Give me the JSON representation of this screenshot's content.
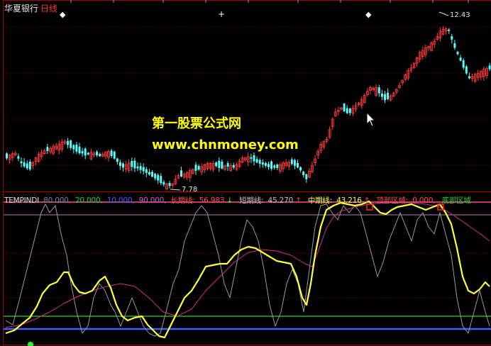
{
  "window": {
    "stock_name": "华夏银行",
    "period": "日线"
  },
  "watermark": {
    "line1": "第一股票公式网",
    "line2": "www.chnmoney.com"
  },
  "price_panel": {
    "high_label": "12.43",
    "low_label": "7.78"
  },
  "indicator_legend": {
    "name": "TEMPINDI",
    "params": [
      {
        "text": "80.000,",
        "color": "#8080a0"
      },
      {
        "text": "20.000,",
        "color": "#30d030"
      },
      {
        "text": "10.000,",
        "color": "#4060ff"
      },
      {
        "text": "90.000,",
        "color": "#d060d0"
      }
    ],
    "long_line": {
      "label": "长期线:",
      "value": "56.983",
      "arrow": "↓",
      "color": "#e05090"
    },
    "short_line": {
      "label": "短期线:",
      "value": "45.270",
      "arrow": "↑",
      "color": "#c0c0c0"
    },
    "mid_line": {
      "label": "中期线:",
      "value": "43.216",
      "arrow": "↑",
      "color": "#ffff40"
    },
    "top_zone": {
      "label": "顶部区域:",
      "value": "0.000,",
      "color": "#ff5050"
    },
    "bottom_zone": {
      "label": "底部区域",
      "color": "#30d030"
    }
  },
  "colors": {
    "up_candle": "#ff3c3c",
    "down_candle": "#54fcfc",
    "grid": "#800000",
    "level80": "#ff4a8c",
    "level90": "#c090c0",
    "level20": "#30d030",
    "level10": "#4060ff"
  }
}
